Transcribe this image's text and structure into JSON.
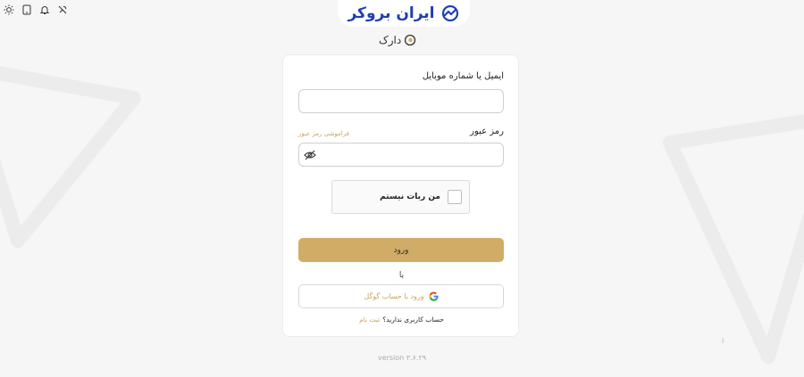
{
  "brand": {
    "name": "ایران بروکر",
    "color": "#1f3fb3"
  },
  "app_logo": {
    "text": "دارک"
  },
  "top_icons": [
    "sun-icon",
    "phone-icon",
    "bell-icon",
    "tool-icon"
  ],
  "form": {
    "email_label": "ایمیل یا شماره موبایل",
    "email_value": "",
    "password_label": "رمز عبور",
    "password_value": "",
    "forgot_link": "فراموشی رمز عبور",
    "captcha_label": "من ربات نیستم",
    "captcha_checked": false,
    "login_button": "ورود",
    "or_text": "یا",
    "google_button": "ورود با حساب گوگل",
    "signup_question": "حساب کاربری ندارید؟",
    "signup_link": "ثبت نام"
  },
  "version": "version ۳.۶.۲۹",
  "corner_mark": "i",
  "colors": {
    "accent": "#d1ac66",
    "link": "#c9a45f",
    "background": "#f6f6f6"
  }
}
